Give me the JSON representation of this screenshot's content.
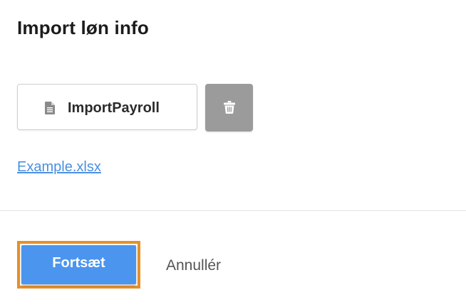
{
  "dialog": {
    "title": "Import løn info"
  },
  "file": {
    "name": "ImportPayroll",
    "icon": "document-icon"
  },
  "delete_button": {
    "icon": "trash-icon",
    "color": "#9b9b9b"
  },
  "example_link": {
    "label": "Example.xlsx"
  },
  "actions": {
    "continue_label": "Fortsæt",
    "cancel_label": "Annullér"
  },
  "colors": {
    "primary": "#4b95ee",
    "focus_outline": "#e5902b",
    "link": "#4a90e2"
  }
}
